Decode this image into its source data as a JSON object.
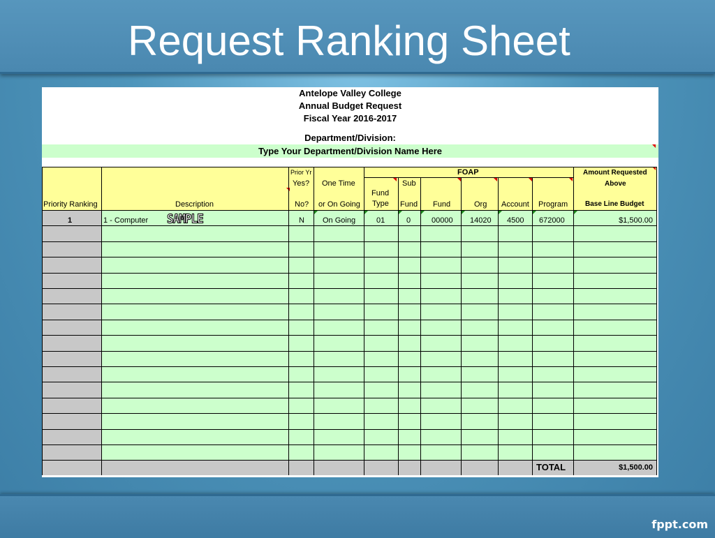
{
  "slide": {
    "title": "Request Ranking Sheet",
    "brand": "fppt.com"
  },
  "sheet": {
    "org": "Antelope Valley College",
    "doc_title": "Annual Budget Request",
    "fiscal_year": "Fiscal Year 2016-2017",
    "dept_label": "Department/Division:",
    "dept_placeholder": "Type Your Department/Division Name Here",
    "headers": {
      "priority": "Priority Ranking",
      "description": "Description",
      "prior_yr": "Prior Yr",
      "yes": "Yes?",
      "no": "No?",
      "one_time": "One Time",
      "or_on_going": "or On Going",
      "foap": "FOAP",
      "fund_type_1": "Fund",
      "fund_type_2": "Type",
      "sub": "Sub",
      "sub_fund": "Fund",
      "fund": "Fund",
      "org": "Org",
      "account": "Account",
      "program": "Program",
      "amount_1": "Amount Requested",
      "amount_2": "Above",
      "amount_3": "Base Line Budget"
    },
    "rows": [
      {
        "priority": "1",
        "description": "1 - Computer",
        "prior_yr": "N",
        "one_time": "On Going",
        "fund_type": "01",
        "sub_fund": "0",
        "fund": "00000",
        "org": "14020",
        "account": "4500",
        "program": "672000",
        "amount": "$1,500.00"
      }
    ],
    "stamp": "SAMPLE",
    "total_label": "TOTAL",
    "total_value": "$1,500.00",
    "colors": {
      "header_fill": "#ffff99",
      "entry_fill": "#ccffcc",
      "rank_fill": "#c8c8c8"
    }
  }
}
